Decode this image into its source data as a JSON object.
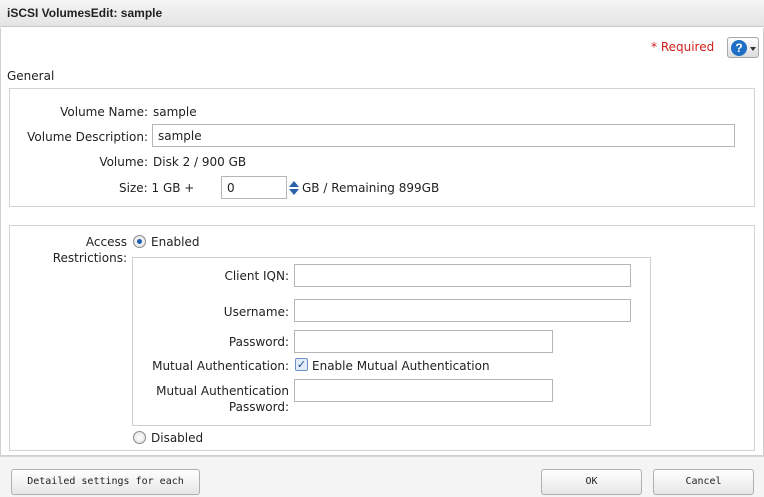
{
  "window": {
    "title": "iSCSI VolumesEdit: sample"
  },
  "header": {
    "required_label": "* Required",
    "help_icon": "question-circle-icon"
  },
  "general": {
    "section_title": "General",
    "volume_name_label": "Volume Name:",
    "volume_name_value": "sample",
    "volume_description_label": "Volume Description:",
    "volume_description_value": "sample",
    "volume_label": "Volume:",
    "volume_value": "Disk 2 / 900 GB",
    "size_label": "Size: 1 GB +",
    "size_value": "0",
    "size_suffix": "GB / Remaining 899GB"
  },
  "access": {
    "label_line1": "Access",
    "label_line2": "Restrictions:",
    "enabled_label": "Enabled",
    "enabled_selected": true,
    "client_iqn_label": "Client IQN:",
    "client_iqn_value": "",
    "username_label": "Username:",
    "username_value": "",
    "password_label": "Password:",
    "password_value": "",
    "mutual_auth_label": "Mutual Authentication:",
    "mutual_auth_checkbox_label": "Enable Mutual Authentication",
    "mutual_auth_checked": true,
    "mutual_auth_password_label_line1": "Mutual Authentication",
    "mutual_auth_password_label_line2": "Password:",
    "mutual_auth_password_value": "",
    "disabled_label": "Disabled"
  },
  "footer": {
    "detail_button": "Detailed settings for each volume",
    "ok_button": "OK",
    "cancel_button": "Cancel"
  },
  "colors": {
    "required_red": "#d0211c",
    "help_blue": "#1f6fc5",
    "radio_blue": "#1c5eb0"
  }
}
